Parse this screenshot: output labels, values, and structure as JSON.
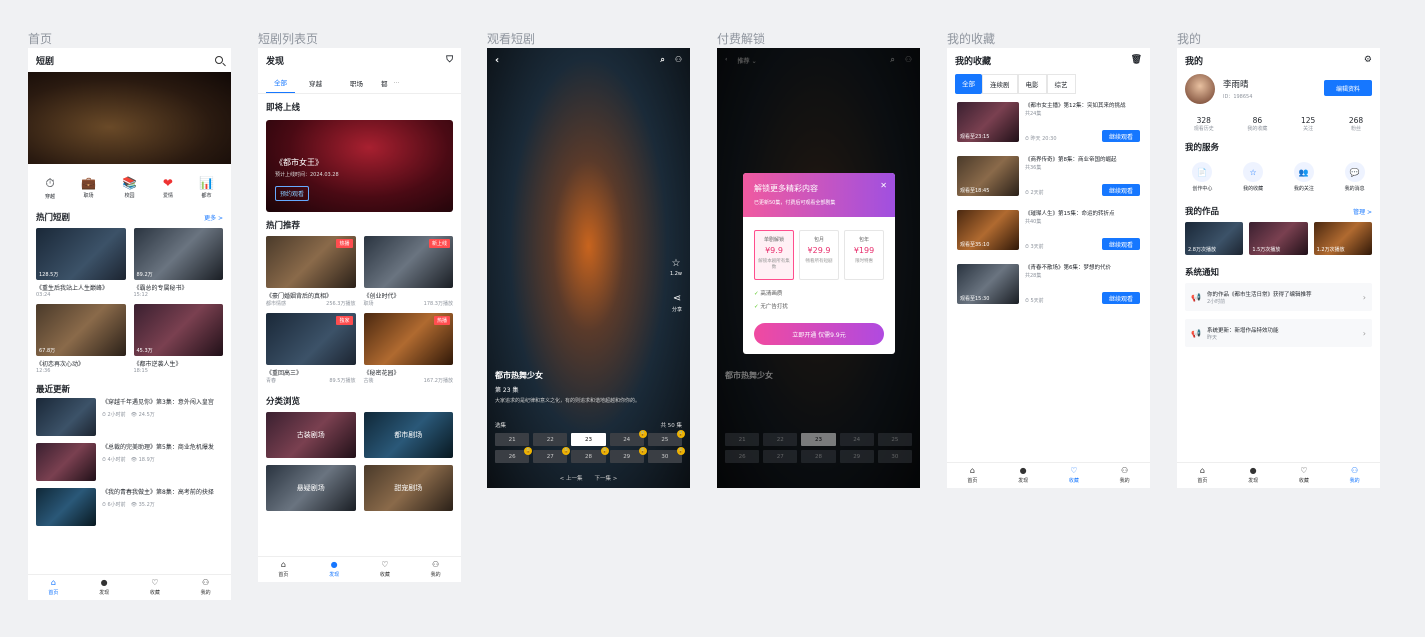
{
  "labels": [
    "首页",
    "短剧列表页",
    "观看短剧",
    "付费解锁",
    "我的收藏",
    "我的"
  ],
  "home": {
    "title": "短剧",
    "categories": [
      {
        "icon": "⏱",
        "label": "穿越"
      },
      {
        "icon": "💼",
        "label": "职场"
      },
      {
        "icon": "📚",
        "label": "校园"
      },
      {
        "icon": "❤",
        "label": "爱情"
      },
      {
        "icon": "📊",
        "label": "都市"
      }
    ],
    "hot_title": "热门短剧",
    "hot_more": "更多 >",
    "hot": [
      {
        "title": "《重生后我站上人生巅峰》",
        "meta": "03:24",
        "views": "128.5万",
        "bg": "bg1"
      },
      {
        "title": "《霸总的专属秘书》",
        "meta": "15:12",
        "views": "89.2万",
        "bg": "bg3"
      },
      {
        "title": "《初恋再次心动》",
        "meta": "12:36",
        "views": "67.8万",
        "bg": "bg2"
      },
      {
        "title": "《都市逆袭人生》",
        "meta": "18:15",
        "views": "45.3万",
        "bg": "bg4"
      }
    ],
    "recent_title": "最近更新",
    "recent": [
      {
        "title": "《穿越千年遇见你》第3集：意外闯入皇宫",
        "time": "2小时前",
        "views": "24.5万",
        "bg": "bg1"
      },
      {
        "title": "《总裁的完美助理》第5集：商业危机爆发",
        "time": "4小时前",
        "views": "18.9万",
        "bg": "bg4"
      },
      {
        "title": "《我的青春我做主》第8集：高考前的抉择",
        "time": "6小时前",
        "views": "35.2万",
        "bg": "bg6"
      }
    ],
    "tabs": [
      "首页",
      "发现",
      "收藏",
      "我的"
    ]
  },
  "list": {
    "title": "发现",
    "tabs": [
      "全部",
      "穿越",
      "职场",
      "都"
    ],
    "upcoming_title": "即将上线",
    "banner": {
      "title": "《都市女王》",
      "sub": "预计上线时间：2024.03.28",
      "btn": "预约观看"
    },
    "rec_title": "热门推荐",
    "rec": [
      {
        "title": "《豪门婚姻背后的真相》",
        "cat": "都市情感",
        "views": "256.3万播放",
        "badge": "热播",
        "bg": "bg2"
      },
      {
        "title": "《创业时代》",
        "cat": "职场",
        "views": "178.3万播放",
        "badge": "新上线",
        "bg": "bg3"
      },
      {
        "title": "《重回高三》",
        "cat": "青春",
        "views": "89.5万播放",
        "badge": "独家",
        "bg": "bg1"
      },
      {
        "title": "《秘密花园》",
        "cat": "古装",
        "views": "167.2万播放",
        "badge": "热播",
        "bg": "bg5"
      }
    ],
    "cat_title": "分类浏览",
    "cats": [
      {
        "label": "古装剧场",
        "bg": "bg4"
      },
      {
        "label": "都市剧场",
        "bg": "bg6"
      },
      {
        "label": "悬疑剧场",
        "bg": "bg3"
      },
      {
        "label": "甜宠剧场",
        "bg": "bg2"
      }
    ],
    "tabbar": [
      "首页",
      "发现",
      "收藏",
      "我的"
    ]
  },
  "watch": {
    "title": "都市热舞少女",
    "episode": "第 23 集",
    "desc": "大家追求的是纪律和意义之化，有的则追求和谐地超越和你你的。",
    "likes": "1.2w",
    "share": "分享",
    "ep_label": "选集",
    "ep_count": "共 50 集",
    "eps": [
      "21",
      "22",
      "23",
      "24",
      "25",
      "26",
      "27",
      "28",
      "29",
      "30"
    ],
    "prev": "< 上一集",
    "next": "下一集 >"
  },
  "pay": {
    "top": "推荐",
    "modal_title": "解锁更多精彩内容",
    "modal_sub": "已更新50集，付费后可观看全部剧集",
    "plans": [
      {
        "name": "单剧解锁",
        "price": "¥9.9",
        "desc": "解锁本剧所有集数"
      },
      {
        "name": "包月",
        "price": "¥29.9",
        "desc": "畅看所有短剧"
      },
      {
        "name": "包年",
        "price": "¥199",
        "desc": "限时特惠"
      }
    ],
    "benefits": [
      "高清画质",
      "无广告打扰"
    ],
    "btn": "立即开通 仅需9.9元"
  },
  "fav": {
    "title": "我的收藏",
    "tabs": [
      "全部",
      "连续剧",
      "电影",
      "综艺"
    ],
    "items": [
      {
        "title": "《都市女主播》第12集：突如其来的挑战",
        "eps": "共24集",
        "time": "昨天 20:30",
        "watched": "观看至23:15",
        "btn": "继续观看",
        "bg": "bg4"
      },
      {
        "title": "《商界传奇》第8集：商业帝国的崛起",
        "eps": "共36集",
        "time": "2天前",
        "watched": "观看至18:45",
        "btn": "继续观看",
        "bg": "bg2"
      },
      {
        "title": "《璀璨人生》第15集：命运的转折点",
        "eps": "共40集",
        "time": "3天前",
        "watched": "观看至35:10",
        "btn": "继续观看",
        "bg": "bg5"
      },
      {
        "title": "《青春不散场》第6集：梦想的代价",
        "eps": "共28集",
        "time": "5天前",
        "watched": "观看至15:30",
        "btn": "继续观看",
        "bg": "bg3"
      }
    ],
    "tabbar": [
      "首页",
      "发现",
      "收藏",
      "我的"
    ]
  },
  "me": {
    "title": "我的",
    "name": "李雨晴",
    "uid": "ID：198654",
    "edit": "编辑资料",
    "stats": [
      {
        "n": "328",
        "l": "观看历史"
      },
      {
        "n": "86",
        "l": "我的收藏"
      },
      {
        "n": "125",
        "l": "关注"
      },
      {
        "n": "268",
        "l": "粉丝"
      }
    ],
    "svc_title": "我的服务",
    "svcs": [
      {
        "icon": "📄",
        "l": "创作中心"
      },
      {
        "icon": "☆",
        "l": "我的收藏"
      },
      {
        "icon": "👥",
        "l": "我的关注"
      },
      {
        "icon": "💬",
        "l": "我的消息"
      }
    ],
    "works_title": "我的作品",
    "works_more": "管理 >",
    "works": [
      {
        "v": "2.8万次播放",
        "bg": "bg1"
      },
      {
        "v": "1.5万次播放",
        "bg": "bg4"
      },
      {
        "v": "1.2万次播放",
        "bg": "bg5"
      }
    ],
    "notice_title": "系统通知",
    "notices": [
      {
        "t": "你的作品《都市生活日常》获得了编辑推荐",
        "time": "2小时前"
      },
      {
        "t": "系统更新：新增作品特效功能",
        "time": "昨天"
      }
    ],
    "tabbar": [
      "首页",
      "发现",
      "收藏",
      "我的"
    ]
  }
}
